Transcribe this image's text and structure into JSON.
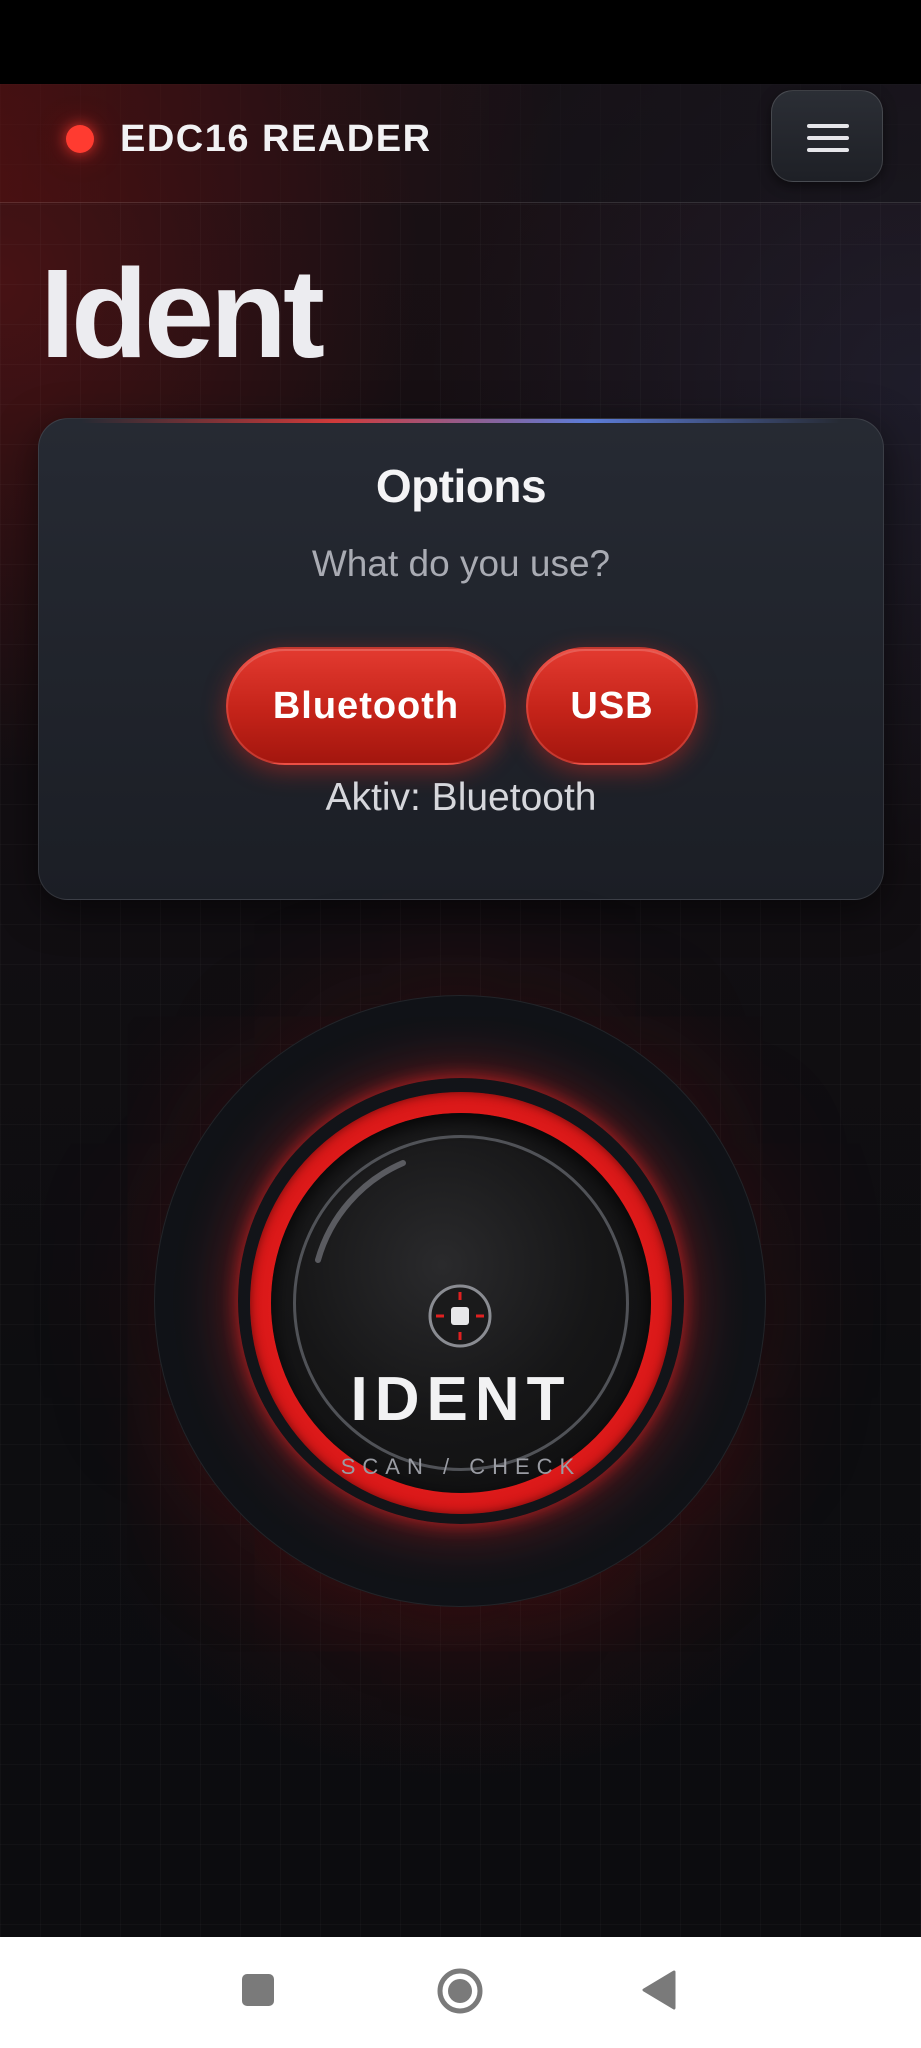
{
  "header": {
    "title": "EDC16 READER",
    "status_color": "#ff3b30",
    "menu_icon": "hamburger-menu-icon"
  },
  "page": {
    "title": "Ident"
  },
  "options": {
    "title": "Options",
    "subtitle": "What do you use?",
    "buttons": [
      {
        "label": "Bluetooth"
      },
      {
        "label": "USB"
      }
    ],
    "active_label": "Aktiv: Bluetooth"
  },
  "ident_button": {
    "label": "IDENT",
    "sublabel": "SCAN / CHECK",
    "icon": "crosshair-icon",
    "accent_color": "#e21b1b"
  },
  "nav": {
    "recents_icon": "recents-square-icon",
    "home_icon": "home-circle-icon",
    "back_icon": "back-triangle-icon"
  }
}
